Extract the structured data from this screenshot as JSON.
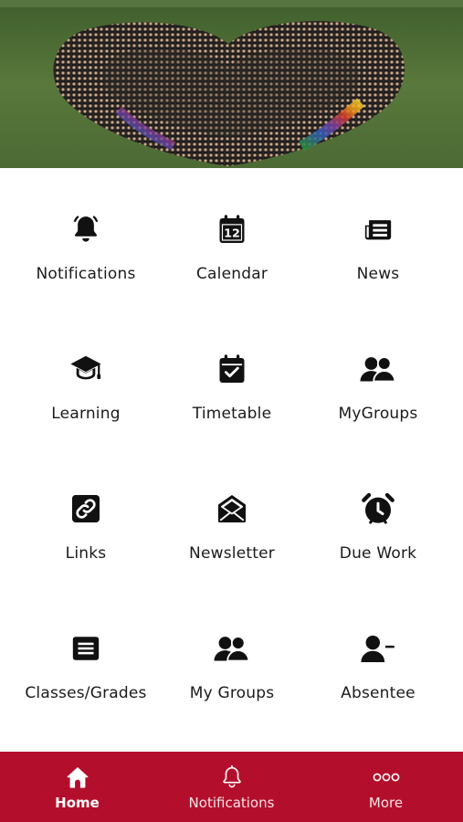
{
  "colors": {
    "accent": "#b30f2c",
    "icon": "#111111",
    "label": "#1b1b1b",
    "nav_text": "#ffffff"
  },
  "hero": {
    "image": "school-photo-heart"
  },
  "tiles": [
    {
      "label": "Notifications",
      "icon": "bell-icon"
    },
    {
      "label": "Calendar",
      "icon": "calendar-icon",
      "day": "12"
    },
    {
      "label": "News",
      "icon": "newspaper-icon"
    },
    {
      "label": "Learning",
      "icon": "graduation-cap-icon"
    },
    {
      "label": "Timetable",
      "icon": "calendar-check-icon"
    },
    {
      "label": "MyGroups",
      "icon": "users-icon"
    },
    {
      "label": "Links",
      "icon": "link-icon"
    },
    {
      "label": "Newsletter",
      "icon": "envelope-open-icon"
    },
    {
      "label": "Due Work",
      "icon": "alarm-clock-icon"
    },
    {
      "label": "Classes/Grades",
      "icon": "list-icon"
    },
    {
      "label": "My Groups",
      "icon": "users-icon"
    },
    {
      "label": "Absentee",
      "icon": "user-minus-icon"
    }
  ],
  "bottom_nav": {
    "active": "Home",
    "items": [
      {
        "label": "Home",
        "icon": "home-icon"
      },
      {
        "label": "Notifications",
        "icon": "bell-outline-icon"
      },
      {
        "label": "More",
        "icon": "more-dots-icon"
      }
    ]
  }
}
